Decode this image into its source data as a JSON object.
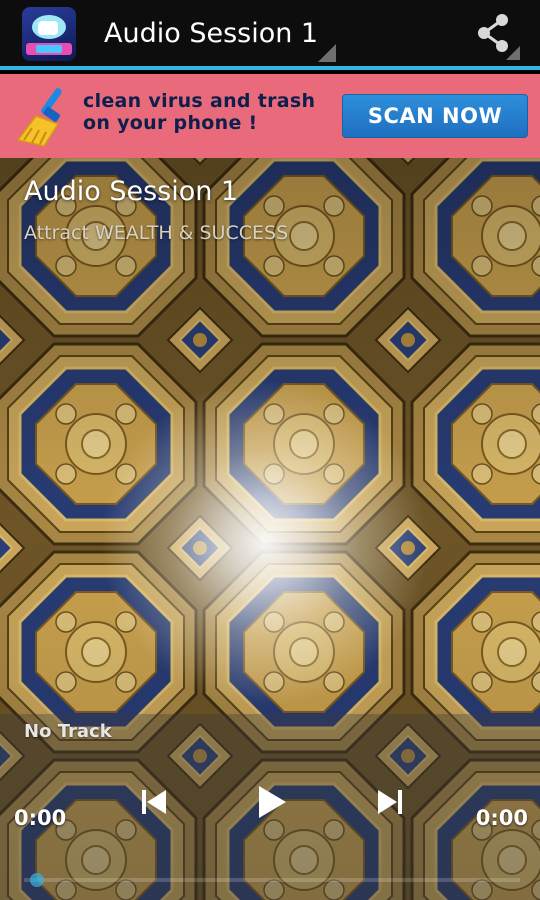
{
  "actionbar": {
    "title": "Audio Session 1",
    "app_icon": "app-launcher-icon",
    "share_icon": "share-icon",
    "accent_color": "#33b5e5"
  },
  "ad": {
    "icon": "broom-icon",
    "text_line1": "clean virus and trash",
    "text_line2": "on your phone !",
    "cta_label": "SCAN NOW",
    "info_icon": "i",
    "background_color": "#e96a7a",
    "cta_color": "#2d8fdb"
  },
  "session": {
    "title": "Audio Session 1",
    "subtitle": "Attract WEALTH & SUCCESS"
  },
  "player": {
    "track_label": "No Track",
    "elapsed": "0:00",
    "duration": "0:00",
    "progress_fraction": 0,
    "prev_icon": "skip-previous-icon",
    "play_icon": "play-icon",
    "next_icon": "skip-next-icon"
  }
}
